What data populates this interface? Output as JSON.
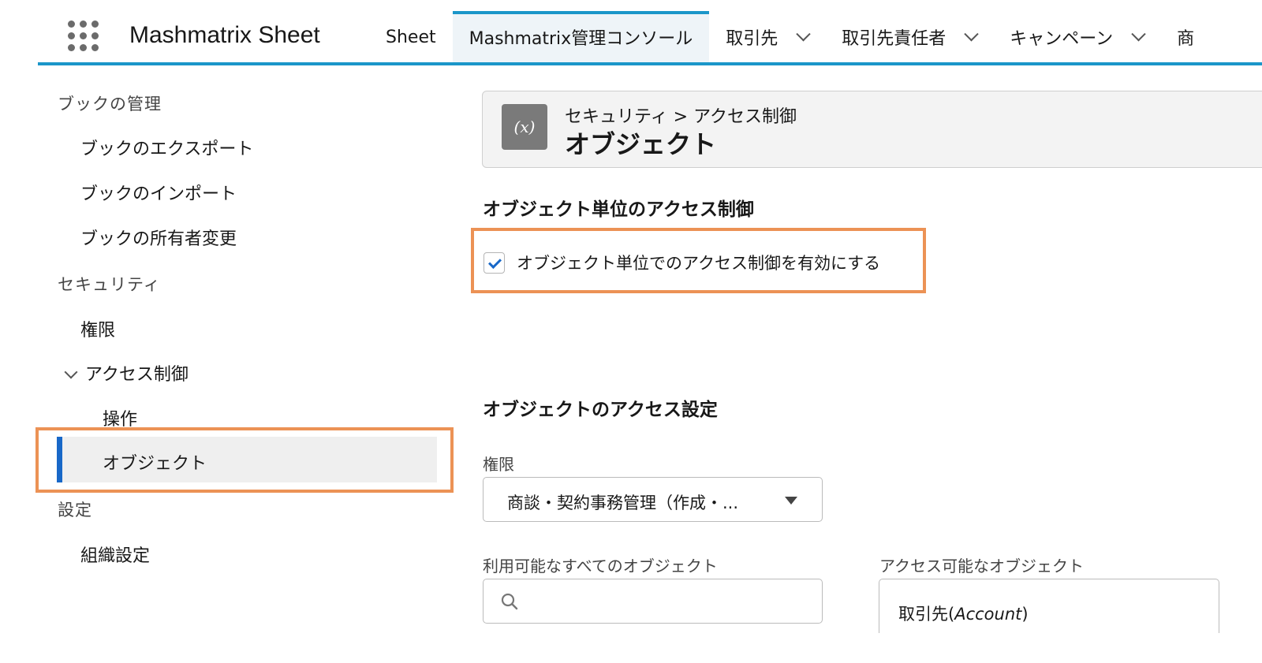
{
  "app": {
    "name": "Mashmatrix Sheet"
  },
  "nav": {
    "items": [
      {
        "label": "Sheet",
        "has_menu": false,
        "active": false
      },
      {
        "label": "Mashmatrix管理コンソール",
        "has_menu": false,
        "active": true
      },
      {
        "label": "取引先",
        "has_menu": true,
        "active": false
      },
      {
        "label": "取引先責任者",
        "has_menu": true,
        "active": false
      },
      {
        "label": "キャンペーン",
        "has_menu": true,
        "active": false
      },
      {
        "label": "商",
        "has_menu": false,
        "active": false
      }
    ]
  },
  "sidebar": {
    "book_section": "ブックの管理",
    "book_export": "ブックのエクスポート",
    "book_import": "ブックのインポート",
    "book_owner": "ブックの所有者変更",
    "security_section": "セキュリティ",
    "permissions": "権限",
    "access_control": "アクセス制御",
    "operations": "操作",
    "objects": "オブジェクト",
    "settings_section": "設定",
    "org_settings": "組織設定"
  },
  "header": {
    "icon": "variable-icon",
    "icon_glyph": "(x)",
    "breadcrumb": "セキュリティ > アクセス制御",
    "title": "オブジェクト"
  },
  "object_access": {
    "heading": "オブジェクト単位のアクセス制御",
    "checkbox_label": "オブジェクト単位でのアクセス制御を有効にする",
    "checked": true
  },
  "object_settings": {
    "heading": "オブジェクトのアクセス設定",
    "permission_label": "権限",
    "permission_value": "商談・契約事務管理（作成・...",
    "available_label": "利用可能なすべてのオブジェクト",
    "search_value": "",
    "accessible_label": "アクセス可能なオブジェクト",
    "accessible_items": [
      {
        "ja": "取引先",
        "en": "Account"
      }
    ]
  },
  "colors": {
    "accent": "#1b96c9",
    "selection_bar": "#1868c8",
    "highlight": "#ec9255"
  }
}
